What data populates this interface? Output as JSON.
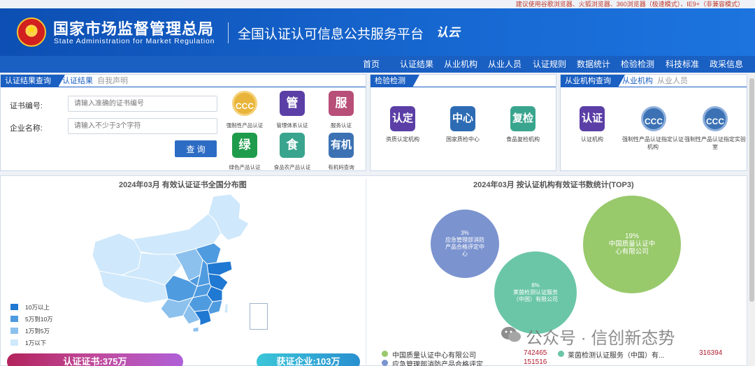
{
  "browser_note": "建议使用谷歌浏览器、火狐浏览器、360浏览器（极速模式）、IE9+（非兼容模式）",
  "header": {
    "org_cn": "国家市场监督管理总局",
    "org_en": "State Administration  for  Market Regulation",
    "platform": "全国认证认可信息公共服务平台",
    "logo_mark": "认云"
  },
  "nav": [
    "首页",
    "认证结果",
    "从业机构",
    "从业人员",
    "认证规则",
    "数据统计",
    "检验检测",
    "科技标准",
    "政采信息"
  ],
  "cert_query": {
    "tab_active": "认证结果查询",
    "tabs": [
      "认证结果",
      "自我声明"
    ],
    "cert_no_label": "证书编号:",
    "cert_no_placeholder": "请输入准确的证书编号",
    "company_label": "企业名称:",
    "company_placeholder": "请输入不少于3个字符",
    "query_button": "查 询",
    "tiles": [
      {
        "glyph": "CCC",
        "caption": "强制性产品认证",
        "color": "#e9b43a"
      },
      {
        "glyph": "管",
        "caption": "管理体系认证",
        "color": "#5b3fa6"
      },
      {
        "glyph": "服",
        "caption": "服务认证",
        "color": "#b84f78"
      },
      {
        "glyph": "绿",
        "caption": "绿色产品认证",
        "color": "#1f9c4b"
      },
      {
        "glyph": "食",
        "caption": "食品农产品认证",
        "color": "#3aa58e"
      },
      {
        "glyph": "有机",
        "caption": "有机码查询",
        "color": "#3c72b4"
      }
    ]
  },
  "inspection": {
    "tab_active": "检验检测",
    "tiles": [
      {
        "glyph": "认定",
        "caption": "资质认定机构",
        "color": "#5b3fa6"
      },
      {
        "glyph": "中心",
        "caption": "国家质检中心",
        "color": "#2d6cb4"
      },
      {
        "glyph": "复检",
        "caption": "食品复检机构",
        "color": "#3aa58e"
      }
    ]
  },
  "org_query": {
    "tab_active": "从业机构查询",
    "tabs": [
      "从业机构",
      "从业人员"
    ],
    "tiles": [
      {
        "glyph": "认证",
        "caption": "认证机构",
        "color": "#5b3fa6"
      },
      {
        "glyph": "CCC",
        "caption": "强制性产品认证指定认证机构",
        "color": "#3c72b4"
      },
      {
        "glyph": "CCC",
        "caption": "强制性产品认证指定实验室",
        "color": "#3c72b4"
      }
    ]
  },
  "map_section": {
    "title": "2024年03月  有效认证证书全国分布图",
    "legend": [
      {
        "label": "10万以上",
        "color": "#1f78d1"
      },
      {
        "label": "5万到10万",
        "color": "#4f9be0"
      },
      {
        "label": "1万到5万",
        "color": "#8cc1ee"
      },
      {
        "label": "1万以下",
        "color": "#cfe8fb"
      }
    ],
    "stat_cert": "认证证书:375万",
    "stat_company": "获证企业:103万"
  },
  "top3_section": {
    "title": "2024年03月   按认证机构有效证书数统计(TOP3)",
    "bubbles": [
      {
        "percent": "3%",
        "name": "应急管理部消防产品合格评定中心",
        "color": "#7b93cf"
      },
      {
        "percent": "8%",
        "name": "莱茵检测认证服务（中国）有限公司",
        "color": "#6bc6a8"
      },
      {
        "percent": "19%",
        "name": "中国质量认证中心有限公司",
        "color": "#98c96b"
      }
    ],
    "list": [
      {
        "name": "中国质量认证中心有限公司",
        "value": "742465",
        "color": "#98c96b"
      },
      {
        "name": "莱茵检测认证服务（中国）有...",
        "value": "316394",
        "color": "#6bc6a8"
      },
      {
        "name": "应急管理部消防产品合格评定...",
        "value": "151516",
        "color": "#7b93cf"
      }
    ]
  },
  "watermark": "公众号 · 信创新态势"
}
